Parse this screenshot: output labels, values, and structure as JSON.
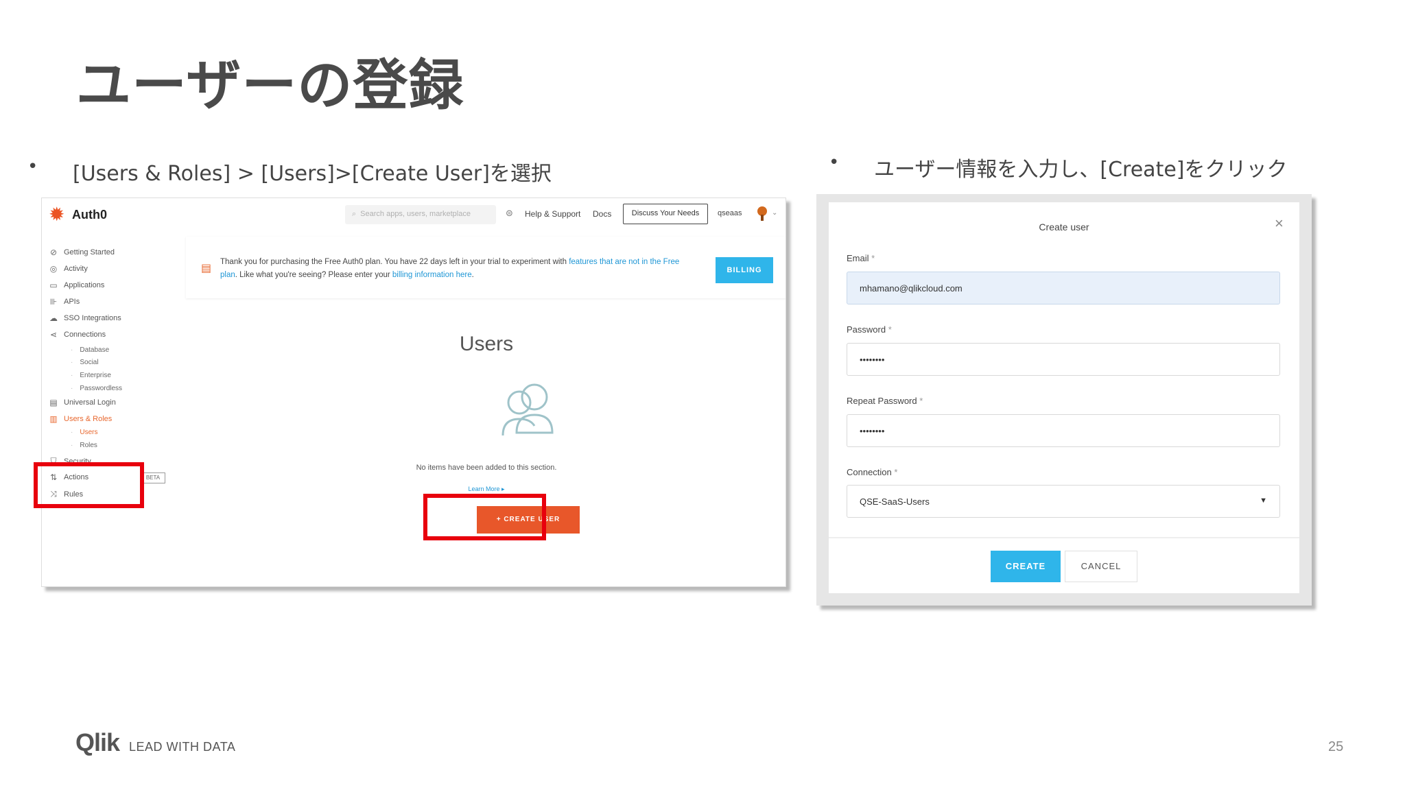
{
  "slide": {
    "title": "ユーザーの登録",
    "page_number": "25"
  },
  "bullets": {
    "left": "[Users & Roles] > [Users]>[Create User]を選択",
    "right": "ユーザー情報を入力し、[Create]をクリック",
    "marker": "•"
  },
  "auth0": {
    "logo_text": "Auth0",
    "search_placeholder": "Search apps, users, marketplace",
    "help": "Help & Support",
    "docs": "Docs",
    "discuss": "Discuss Your Needs",
    "tenant": "qseaas",
    "sidebar": {
      "getting_started": "Getting Started",
      "activity": "Activity",
      "applications": "Applications",
      "apis": "APIs",
      "sso": "SSO Integrations",
      "connections": "Connections",
      "database": "Database",
      "social": "Social",
      "enterprise": "Enterprise",
      "passwordless": "Passwordless",
      "universal_login": "Universal Login",
      "users_roles": "Users & Roles",
      "users": "Users",
      "roles": "Roles",
      "security": "Security",
      "actions": "Actions",
      "beta": "BETA",
      "rules": "Rules"
    },
    "banner": {
      "text_1": "Thank you for purchasing the Free Auth0 plan. You have 22 days left in your trial to experiment with ",
      "link_1": "features that are not in the Free plan",
      "text_2": ". Like what you're seeing? Please enter your ",
      "link_2": "billing information here",
      "text_3": ".",
      "billing_button": "BILLING"
    },
    "users_title": "Users",
    "empty_message": "No items have been added to this section.",
    "learn_more": "Learn More ▸",
    "create_user_button": "+ CREATE USER"
  },
  "dialog": {
    "title": "Create user",
    "email_label": "Email",
    "email_value": "mhamano@qlikcloud.com",
    "password_label": "Password",
    "password_value": "••••••••",
    "repeat_label": "Repeat Password",
    "repeat_value": "••••••••",
    "connection_label": "Connection",
    "connection_value": "QSE-SaaS-Users",
    "required_mark": "*",
    "create_button": "CREATE",
    "cancel_button": "CANCEL"
  },
  "footer": {
    "brand": "Qlik",
    "tagline": "LEAD WITH DATA"
  },
  "colors": {
    "highlight": "#e8000d",
    "auth0_orange": "#e8572a",
    "auth0_blue": "#2fb5ea",
    "qlik_green": "#009845"
  }
}
